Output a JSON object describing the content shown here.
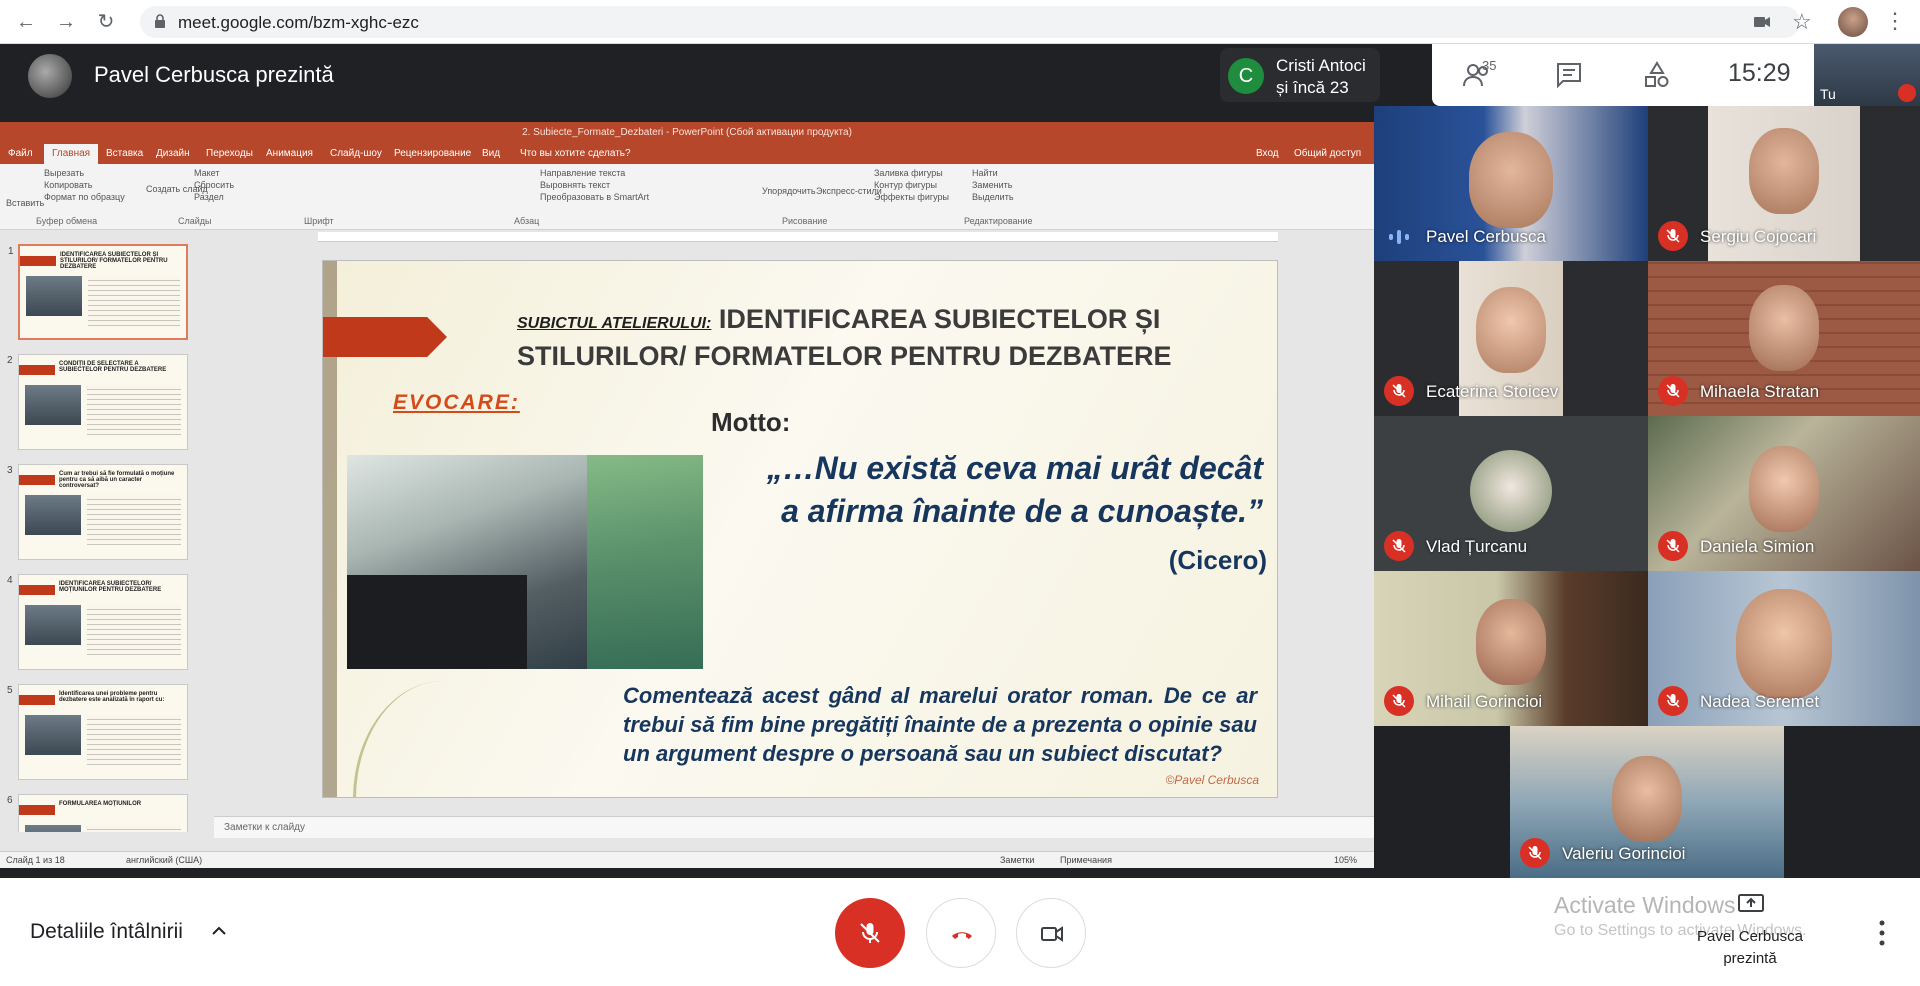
{
  "browser": {
    "url": "meet.google.com/bzm-xghc-ezc"
  },
  "meet": {
    "presenter_title": "Pavel Cerbusca prezintă",
    "joiner_initial": "C",
    "joiner_line1": "Cristi Antoci",
    "joiner_line2": "și încă 23",
    "participants_count": "35",
    "clock": "15:29",
    "self_label": "Tu"
  },
  "powerpoint": {
    "window_title": "2. Subiecte_Formate_Dezbateri - PowerPoint (Сбой активации продукта)",
    "menu": [
      "Файл",
      "Главная",
      "Вставка",
      "Дизайн",
      "Переходы",
      "Анимация",
      "Слайд-шоу",
      "Рецензирование",
      "Вид",
      "Что вы хотите сделать?"
    ],
    "active_menu": "Главная",
    "sign_in": "Вход",
    "share": "Общий доступ",
    "ribbon_groups": [
      "Буфер обмена",
      "Слайды",
      "Шрифт",
      "Абзац",
      "Рисование",
      "Редактирование"
    ],
    "ribbon_items": {
      "paste": "Вставить",
      "cut": "Вырезать",
      "copy": "Копировать",
      "format_painter": "Формат по образцу",
      "new_slide": "Создать слайд",
      "layout": "Макет",
      "reset": "Сбросить",
      "section": "Раздел",
      "text_direction": "Направление текста",
      "align_text": "Выровнять текст",
      "smartart": "Преобразовать в SmartArt",
      "arrange": "Упорядочить",
      "quick_styles": "Экспресс-стили",
      "shape_fill": "Заливка фигуры",
      "shape_outline": "Контур фигуры",
      "shape_effects": "Эффекты фигуры",
      "find": "Найти",
      "replace": "Заменить",
      "select": "Выделить"
    },
    "thumbnails": [
      {
        "num": "1",
        "title": "IDENTIFICAREA SUBIECTELOR ȘI STILURILOR/ FORMATELOR PENTRU DEZBATERE"
      },
      {
        "num": "2",
        "title": "CONDIȚII DE SELECTARE A SUBIECTELOR PENTRU DEZBATERE"
      },
      {
        "num": "3",
        "title": "Cum ar trebui să fie formulată o moțiune pentru ca să aibă un caracter controversat?"
      },
      {
        "num": "4",
        "title": "IDENTIFICAREA SUBIECTELOR/ MOȚIUNILOR PENTRU DEZBATERE"
      },
      {
        "num": "5",
        "title": "Identificarea unei probleme pentru dezbatere este analizată în raport cu:"
      },
      {
        "num": "6",
        "title": "FORMULAREA MOȚIUNILOR"
      }
    ],
    "notes_placeholder": "Заметки к слайду",
    "status_slide": "Слайд 1 из 18",
    "status_lang": "английский (США)",
    "status_notes": "Заметки",
    "status_comments": "Примечания",
    "zoom": "105%"
  },
  "slide": {
    "subject_label": "SUBICTUL ATELIERULUI:",
    "title_line1": "IDENTIFICAREA SUBIECTELOR ȘI",
    "title_line2": "STILURILOR/ FORMATELOR PENTRU DEZBATERE",
    "evocare": "EVOCARE:",
    "motto": "Motto:",
    "quote_line1": "„…Nu există ceva mai urât decât",
    "quote_line2": "a afirma înainte de a cunoaște.”",
    "author": "(Cicero)",
    "discussion": "Comentează acest gând al marelui orator roman. De ce ar trebui să fim bine pregătiți înainte de a prezenta o opinie sau un argument despre o persoană sau un subiect discutat?",
    "credit": "©Pavel Cerbusca"
  },
  "participants": [
    {
      "name": "Pavel Cerbusca",
      "muted": false
    },
    {
      "name": "Sergiu Cojocari",
      "muted": true
    },
    {
      "name": "Ecaterina Stoicev",
      "muted": true
    },
    {
      "name": "Mihaela Stratan",
      "muted": true
    },
    {
      "name": "Vlad Țurcanu",
      "muted": true
    },
    {
      "name": "Daniela Simion",
      "muted": true
    },
    {
      "name": "Mihail Gorincioi",
      "muted": true
    },
    {
      "name": "Nadea Seremet",
      "muted": true
    },
    {
      "name": "Valeriu Gorincioi",
      "muted": true
    }
  ],
  "bottom": {
    "meeting_details": "Detaliile întâlnirii",
    "watermark_title": "Activate Windows",
    "watermark_sub": "Go to Settings to activate Windows.",
    "present_label_line1": "Pavel Cerbusca",
    "present_label_line2": "prezintă"
  },
  "colors": {
    "ppt_accent": "#b7472a",
    "slide_title_blue": "#17365d",
    "evocare_orange": "#d64a1a",
    "mute_red": "#d93025",
    "meet_dark": "#202124"
  }
}
